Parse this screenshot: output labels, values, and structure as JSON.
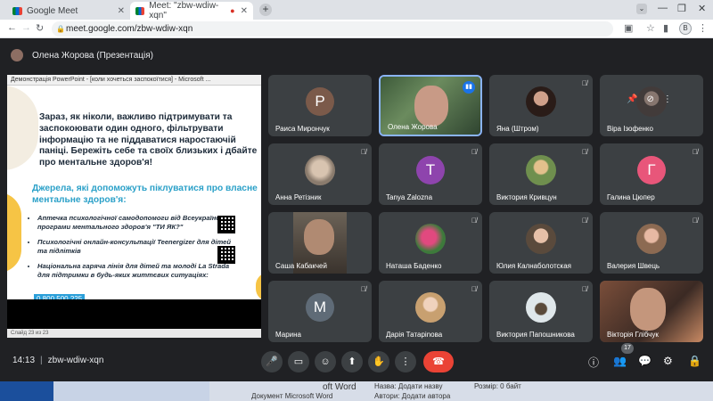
{
  "browser": {
    "tabs": [
      {
        "title": "Google Meet",
        "active": false
      },
      {
        "title": "Meet: \"zbw-wdiw-xqn\"",
        "active": true,
        "recording": true
      }
    ],
    "new_tab": "+",
    "url": "meet.google.com/zbw-wdiw-xqn",
    "profile_initial": "B"
  },
  "meet": {
    "presenter_label": "Олена Жорова (Презентація)",
    "share": {
      "window_title": "Демонстрація PowerPoint - [коли хочеться заспокоїтися] - Microsoft ...",
      "slide_text_1": "Зараз, як ніколи, важливо підтримувати та заспокоювати один одного, фільтрувати інформацію та не піддаватися наростаючій паніці. Бережіть себе та своїх близьких і дбайте про ментальне здоров'я!",
      "slide_text_2": "Джерела, які допоможуть піклуватися про власне ментальне здоров'я:",
      "items": [
        "Аптечка психологічної самодопомоги від Всеукраїнської програми ментального здоров'я \"ТИ ЯК?\"",
        "Психологічні онлайн-консультації Teenergizer для дітей та підлітків",
        "Національна гаряча лінія для дітей та молоді La Strada для підтримки в будь-яких життєвих ситуаціях:"
      ],
      "phone": "0 800 500 225",
      "status": "Слайд 23 из 23"
    },
    "participants": [
      {
        "name": "Раиса Мирончук",
        "initial": "Р",
        "color": "#7b5a4a",
        "type": "avatar"
      },
      {
        "name": "Олена Жорова",
        "type": "video",
        "active": true
      },
      {
        "name": "Яна (Штром)",
        "type": "photo"
      },
      {
        "name": "Віра Ізофенко",
        "type": "photo",
        "hover": true
      },
      {
        "name": "Анна Ретізник",
        "type": "photo"
      },
      {
        "name": "Tanya Zalozna",
        "initial": "T",
        "color": "#8e44ad",
        "type": "avatar"
      },
      {
        "name": "Виктория Кривцун",
        "type": "photo"
      },
      {
        "name": "Галина Цюпер",
        "initial": "Г",
        "color": "#e8567a",
        "type": "avatar"
      },
      {
        "name": "Саша Кабакчей",
        "type": "video"
      },
      {
        "name": "Наташа Баденко",
        "type": "photo"
      },
      {
        "name": "Юлия Калнаболотская",
        "type": "photo"
      },
      {
        "name": "Валерия Швець",
        "type": "photo"
      },
      {
        "name": "Марина",
        "initial": "М",
        "color": "#5f6b77",
        "type": "avatar"
      },
      {
        "name": "Дарія Татаріnова",
        "type": "photo"
      },
      {
        "name": "Виктория Папошникова",
        "type": "photo"
      },
      {
        "name": "Вікторія Глібчук",
        "type": "video"
      }
    ],
    "time": "14:13",
    "meeting_code": "zbw-wdiw-xqn",
    "participant_count": "17"
  },
  "taskbar": {
    "word_label": "oft Word",
    "doc_type": "Документ Microsoft Word",
    "name_label": "Назва: Додати назву",
    "author_label": "Автори: Додати автора",
    "size_label": "Розмір: 0 байт"
  }
}
